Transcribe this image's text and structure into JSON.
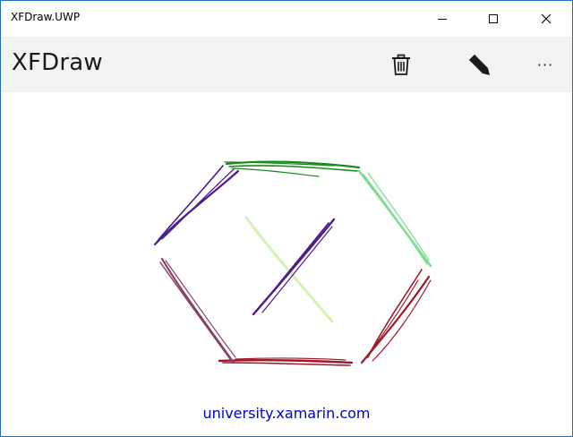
{
  "window": {
    "title": "XFDraw.UWP"
  },
  "commandbar": {
    "page_title": "XFDraw",
    "more_label": "···"
  },
  "footer": {
    "link_text": "university.xamarin.com"
  },
  "icons": {
    "minimize": "minimize-icon",
    "maximize": "maximize-icon",
    "close": "close-icon",
    "clear": "trash-icon",
    "pen": "pen-icon",
    "more": "more-icon"
  },
  "colors": {
    "window_border": "#1f6fc5",
    "commandbar_bg": "#f2f2f2",
    "link": "#0000cc",
    "stroke_green": "#1a8a1a",
    "stroke_light_green": "#7ddc8c",
    "stroke_dark_red": "#a01828",
    "stroke_mauve": "#8a3e6a",
    "stroke_purple": "#4e1a8a",
    "stroke_pale_green": "#d4f2b0"
  }
}
